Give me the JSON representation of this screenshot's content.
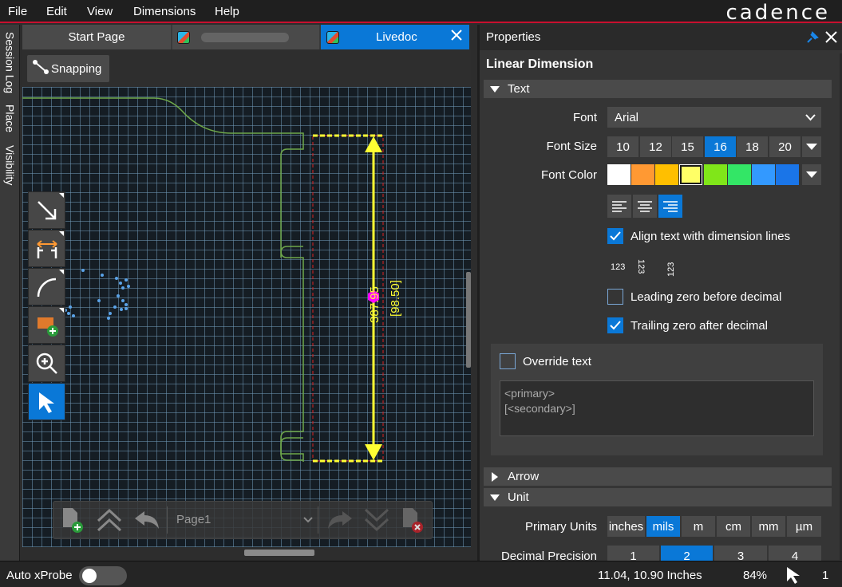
{
  "menu": [
    "File",
    "Edit",
    "View",
    "Dimensions",
    "Help"
  ],
  "brand": "cadence",
  "vertical_tabs": [
    "Session Log",
    "Place",
    "Visibility"
  ],
  "tabs": {
    "start": "Start Page",
    "active": "Livedoc"
  },
  "canvas": {
    "snapping_label": "Snapping",
    "dimension_primary": "387.95",
    "dimension_secondary": "[98.50]",
    "page_name": "Page1"
  },
  "properties": {
    "panel_title": "Properties",
    "heading": "Linear Dimension",
    "sections": {
      "text": "Text",
      "arrow": "Arrow",
      "unit": "Unit"
    },
    "font_label": "Font",
    "font_value": "Arial",
    "font_size_label": "Font Size",
    "font_sizes": [
      "10",
      "12",
      "15",
      "16",
      "18",
      "20"
    ],
    "font_size_selected": "16",
    "font_color_label": "Font Color",
    "font_colors": [
      "#ffffff",
      "#ff9933",
      "#ffbf00",
      "#ffff66",
      "#80e619",
      "#33e666",
      "#3399ff",
      "#1a75e8"
    ],
    "font_color_selected": "#ffff66",
    "align_text_label": "Align text with dimension lines",
    "align_text_checked": true,
    "orientation_samples": [
      "123",
      "123",
      "123"
    ],
    "leading_zero_label": "Leading zero before decimal",
    "leading_zero_checked": false,
    "trailing_zero_label": "Trailing zero after decimal",
    "trailing_zero_checked": true,
    "override_label": "Override text",
    "override_checked": false,
    "override_line1": "<primary>",
    "override_line2": "[<secondary>]",
    "primary_units_label": "Primary Units",
    "primary_units": [
      "inches",
      "mils",
      "m",
      "cm",
      "mm",
      "µm"
    ],
    "primary_units_selected": "mils",
    "precision_label": "Decimal Precision",
    "precisions": [
      "1",
      "2",
      "3",
      "4"
    ],
    "precision_selected": "2"
  },
  "status": {
    "auto_xprobe": "Auto xProbe",
    "auto_xprobe_on": false,
    "coords": "11.04, 10.90 Inches",
    "zoom": "84%",
    "count": "1"
  },
  "colors": {
    "accent": "#0a78d7",
    "brand_red": "#c8102e",
    "dimension_yellow": "#ffff33",
    "marker_magenta": "#ff00ff",
    "outline_green": "#6fa84a"
  }
}
